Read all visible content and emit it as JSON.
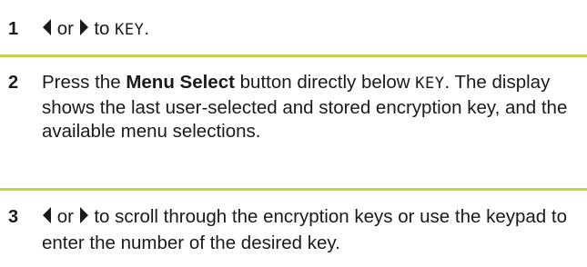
{
  "steps": [
    {
      "number": "1",
      "or_text": "or",
      "to_text": "to",
      "key_label": "KEY",
      "end": "."
    },
    {
      "number": "2",
      "press_text": "Press the",
      "button_name": "Menu Select",
      "button_suffix": "button directly below",
      "key_label": "KEY",
      "end": ".",
      "description": "The display shows the last user-selected and stored encryption key, and the available menu selections."
    },
    {
      "number": "3",
      "or_text": "or",
      "scroll_text": "to scroll through the encryption keys or use the keypad to enter the number of the desired key."
    }
  ],
  "icons": [
    "left-arrow-icon",
    "right-arrow-icon"
  ],
  "colors": {
    "divider": "#c2d14a",
    "text": "#1a1a1a"
  }
}
